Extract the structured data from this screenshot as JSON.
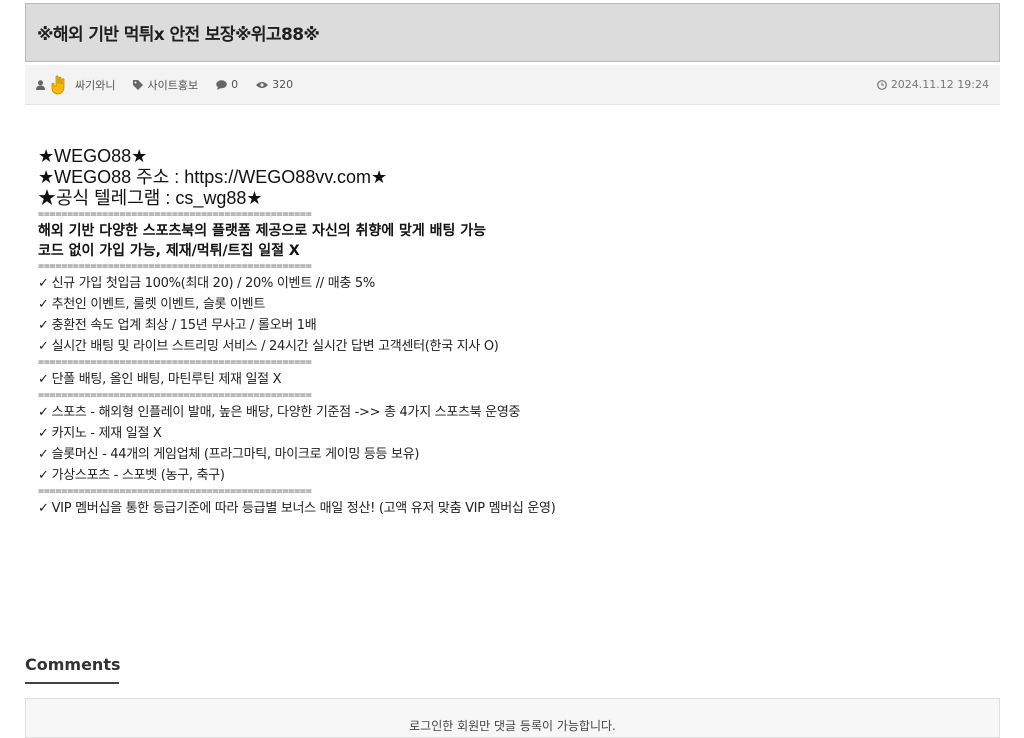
{
  "post": {
    "title": "※해외 기반 먹튀x 안전 보장※위고88※",
    "author": "싸기와니",
    "category": "사이트홍보",
    "comments_count": "0",
    "views": "320",
    "datetime": "2024.11.12 19:24"
  },
  "content": {
    "big_lines": [
      "★WEGO88★",
      "★WEGO88 주소 : https://WEGO88vv.com★",
      "★공식 텔레그램 : cs_wg88★"
    ],
    "separator": "===============================================",
    "bold_lines": [
      "해외 기반 다양한 스포츠북의 플랫폼 제공으로 자신의 취향에 맞게 배팅 가능",
      "코드 없이 가입 가능, 제재/먹튀/트집 일절 X"
    ],
    "group1": [
      "신규 가입 첫입금 100%(최대 20) / 20% 이벤트 // 매충 5%",
      "추천인 이벤트, 룰렛 이벤트, 슬롯 이벤트",
      "충환전 속도 업계 최상 / 15년 무사고 / 롤오버 1배",
      "실시간 배팅 및 라이브 스트리밍 서비스 / 24시간 실시간 답변 고객센터(한국 지사 O)"
    ],
    "group2": [
      "단폴 배팅, 올인 배팅, 마틴루틴 제재 일절 X"
    ],
    "group3": [
      "스포츠 - 해외형 인플레이 발매, 높은 배당, 다양한 기준점 ->> 총 4가지 스포츠북 운영중",
      "카지노 - 제재 일절 X",
      "슬롯머신 - 44개의 게임업체 (프라그마틱, 마이크로 게이밍 등등 보유)",
      "가상스포츠 - 스포벳 (농구, 축구)"
    ],
    "group4": [
      "VIP 멤버십을 통한 등급기준에 따라 등급별 보너스 매일 정산! (고액 유저 맞춤 VIP 멤버십 운영)"
    ],
    "check_mark": "✓"
  },
  "comments": {
    "heading": "Comments",
    "notice": "로그인한 회원만 댓글 등록이 가능합니다."
  }
}
